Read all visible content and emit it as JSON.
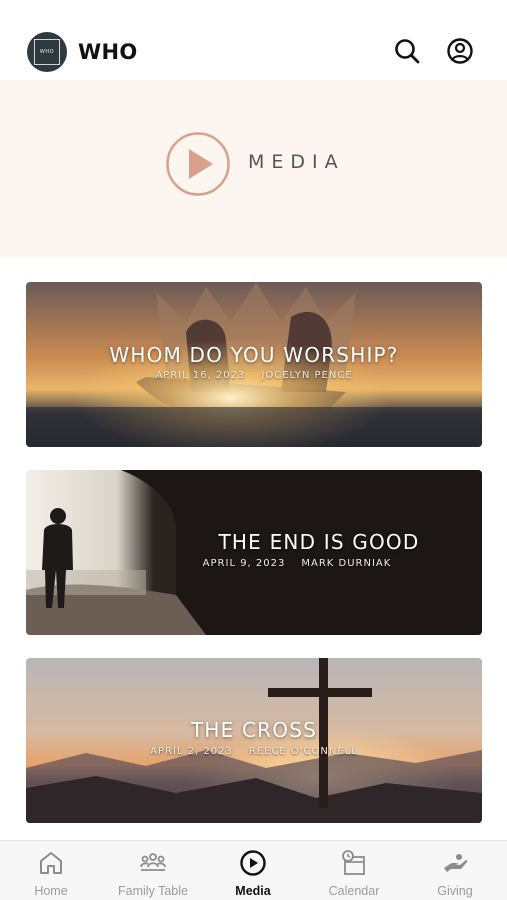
{
  "header": {
    "logo_text": "WHO",
    "app_title": "WHO"
  },
  "hero": {
    "label": "MEDIA"
  },
  "media": [
    {
      "title": "WHOM DO YOU WORSHIP?",
      "date": "APRIL 16, 2023",
      "speaker": "JOCELYN PENCE"
    },
    {
      "title": "THE END IS GOOD",
      "date": "APRIL 9, 2023",
      "speaker": "MARK DURNIAK"
    },
    {
      "title": "THE CROSS",
      "date": "APRIL 2, 2023",
      "speaker": "REECE O'CONNELL"
    }
  ],
  "tabs": [
    {
      "label": "Home",
      "icon": "home-icon",
      "active": false
    },
    {
      "label": "Family Table",
      "icon": "people-icon",
      "active": false
    },
    {
      "label": "Media",
      "icon": "play-circle-icon",
      "active": true
    },
    {
      "label": "Calendar",
      "icon": "calendar-icon",
      "active": false
    },
    {
      "label": "Giving",
      "icon": "giving-hand-icon",
      "active": false
    }
  ],
  "colors": {
    "hero_bg": "#fdf6f0",
    "hero_accent": "#d9a08c",
    "tab_active": "#111111",
    "tab_inactive": "#9a9a9a"
  }
}
